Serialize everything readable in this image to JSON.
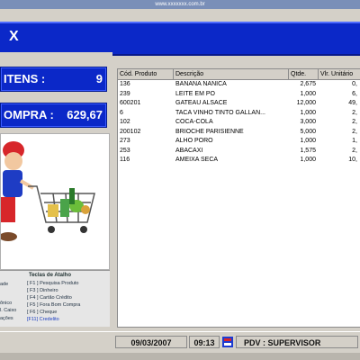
{
  "top_url": "www.xxxxxxx.com.br",
  "title": {
    "close_label": "X"
  },
  "left": {
    "items_label": "ITENS :",
    "items_value": "9",
    "total_label": "OMPRA :",
    "total_value": "629,67"
  },
  "shortcuts": {
    "header": "Teclas de Atalho",
    "items": [
      {
        "key": "[ F1 ]",
        "label": "Pesquisa Produto"
      },
      {
        "key": "[ F3 ]",
        "label": "Dinheiro"
      },
      {
        "key": "[ F4 ]",
        "label": "Cartão Crédito"
      },
      {
        "key": "[ F5 ]",
        "label": "Fora Bom Compra"
      },
      {
        "key": "[ F6 ]",
        "label": "Cheque"
      },
      {
        "key": "[F11]",
        "label": "Credelito"
      }
    ],
    "left_fragments": [
      "ade",
      "ônico",
      "l. Caixo",
      "ações"
    ]
  },
  "table": {
    "columns": [
      "Cód. Produto",
      "Descrição",
      "Qtde.",
      "Vlr. Unitário"
    ],
    "rows": [
      {
        "code": "136",
        "desc": "BANANA NANICA",
        "qty": "2,675",
        "unit": "0,"
      },
      {
        "code": "239",
        "desc": "LEITE EM PO",
        "qty": "1,000",
        "unit": "6,"
      },
      {
        "code": "600201",
        "desc": "GATEAU ALSACE",
        "qty": "12,000",
        "unit": "49,"
      },
      {
        "code": "6",
        "desc": "TACA VINHO TINTO GALLAN...",
        "qty": "1,000",
        "unit": "2,"
      },
      {
        "code": "102",
        "desc": "COCA-COLA",
        "qty": "3,000",
        "unit": "2,"
      },
      {
        "code": "200102",
        "desc": "BRIOCHE PARISIENNE",
        "qty": "5,000",
        "unit": "2,"
      },
      {
        "code": "273",
        "desc": "ALHO PORO",
        "qty": "1,000",
        "unit": "1,"
      },
      {
        "code": "253",
        "desc": "ABACAXI",
        "qty": "1,575",
        "unit": "2,"
      },
      {
        "code": "116",
        "desc": "AMEIXA SECA",
        "qty": "1,000",
        "unit": "10,"
      }
    ]
  },
  "status": {
    "date": "09/03/2007",
    "time": "09:13",
    "pdv": "PDV :  SUPERVISOR"
  }
}
